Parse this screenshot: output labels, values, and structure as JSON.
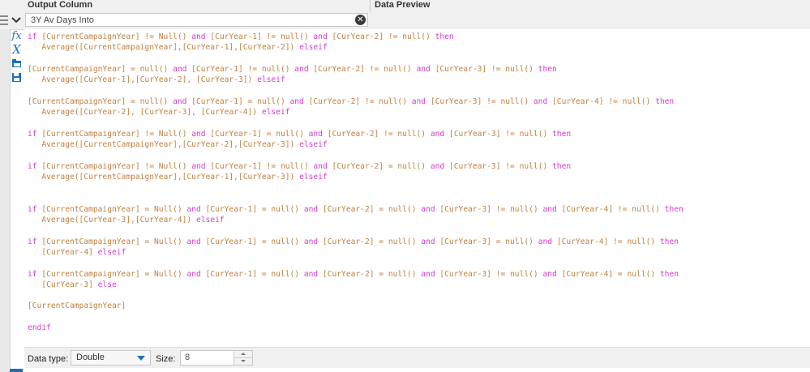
{
  "header": {
    "output_column_label": "Output Column",
    "data_preview_label": "Data Preview"
  },
  "field": {
    "value": "3Y Av Days Into"
  },
  "toolbox": {
    "icons": [
      "function-icon",
      "variable-icon",
      "open-icon",
      "save-icon"
    ],
    "fx_glyph": "fx",
    "x_glyph": "X"
  },
  "expression_lines": [
    "if [CurrentCampaignYear] != Null() and [CurYear-1] != null() and [CurYear-2] != null() then",
    "   Average([CurrentCampaignYear],[CurYear-1],[CurYear-2]) elseif",
    "",
    "[CurrentCampaignYear] = null() and [CurYear-1] != null() and [CurYear-2] != null() and [CurYear-3] != null() then",
    "   Average([CurYear-1],[CurYear-2], [CurYear-3]) elseif",
    "",
    "[CurrentCampaignYear] = null() and [CurYear-1] = null() and [CurYear-2] != null() and [CurYear-3] != null() and [CurYear-4] != null() then",
    "   Average([CurYear-2], [CurYear-3], [CurYear-4]) elseif",
    "",
    "if [CurrentCampaignYear] != Null() and [CurYear-1] = null() and [CurYear-2] != null() and [CurYear-3] != null() then",
    "   Average([CurrentCampaignYear],[CurYear-2],[CurYear-3]) elseif",
    "",
    "if [CurrentCampaignYear] != Null() and [CurYear-1] != null() and [CurYear-2] = null() and [CurYear-3] != null() then",
    "   Average([CurrentCampaignYear],[CurYear-1],[CurYear-3]) elseif",
    "",
    "",
    "if [CurrentCampaignYear] = Null() and [CurYear-1] = null() and [CurYear-2] = null() and [CurYear-3] != null() and [CurYear-4] != null() then",
    "   Average([CurYear-3],[CurYear-4]) elseif",
    "",
    "if [CurrentCampaignYear] = Null() and [CurYear-1] = null() and [CurYear-2] = null() and [CurYear-3] = null() and [CurYear-4] != null() then",
    "   [CurYear-4] elseif",
    "",
    "if [CurrentCampaignYear] = Null() and [CurYear-1] = null() and [CurYear-2] = null() and [CurYear-3] != null() and [CurYear-4] = null() then",
    "   [CurYear-3] else",
    "",
    "[CurrentCampaignYear]",
    "",
    "endif"
  ],
  "keywords": [
    "if",
    "and",
    "then",
    "elseif",
    "else",
    "endif"
  ],
  "colors": {
    "keyword": "#d63ccd",
    "text": "#c08040",
    "accent": "#1e6fb8"
  },
  "bottom": {
    "data_type_label": "Data type:",
    "data_type_value": "Double",
    "size_label": "Size:",
    "size_value": "8"
  }
}
